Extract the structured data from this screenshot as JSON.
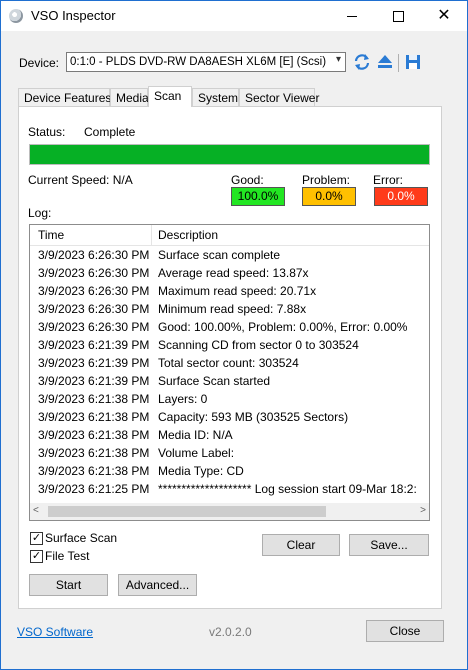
{
  "window": {
    "title": "VSO Inspector",
    "minimize": "–",
    "maximize": "□",
    "close": "✕"
  },
  "toolbar": {
    "device_label": "Device:",
    "device_value": "0:1:0 - PLDS DVD-RW DA8AESH XL6M [E] (Scsi)",
    "dropdown_arrow": "▾"
  },
  "tabs": [
    "Device Features",
    "Media",
    "Scan",
    "System",
    "Sector Viewer"
  ],
  "active_tab": "Scan",
  "scan": {
    "status_label": "Status:",
    "status_value": "Complete",
    "progress_fraction": 1.0,
    "progress_color": "#06b025",
    "speed_label": "Current Speed: N/A",
    "good_label": "Good:",
    "good_value": "100.0%",
    "good_color": "#22e622",
    "problem_label": "Problem:",
    "problem_value": "0.0%",
    "problem_color": "#ffc000",
    "error_label": "Error:",
    "error_value": "0.0%",
    "error_color": "#ff3b1a",
    "log_label": "Log:"
  },
  "log": {
    "columns": [
      "Time",
      "Description"
    ],
    "rows": [
      {
        "time": "3/9/2023 6:26:30 PM",
        "desc": "Surface scan complete"
      },
      {
        "time": "3/9/2023 6:26:30 PM",
        "desc": "Average read speed: 13.87x"
      },
      {
        "time": "3/9/2023 6:26:30 PM",
        "desc": "Maximum read speed: 20.71x"
      },
      {
        "time": "3/9/2023 6:26:30 PM",
        "desc": "Minimum read speed: 7.88x"
      },
      {
        "time": "3/9/2023 6:26:30 PM",
        "desc": "Good: 100.00%, Problem: 0.00%, Error: 0.00%"
      },
      {
        "time": "3/9/2023 6:21:39 PM",
        "desc": "Scanning CD from sector 0 to 303524"
      },
      {
        "time": "3/9/2023 6:21:39 PM",
        "desc": "Total sector count: 303524"
      },
      {
        "time": "3/9/2023 6:21:39 PM",
        "desc": "Surface Scan started"
      },
      {
        "time": "3/9/2023 6:21:38 PM",
        "desc": "Layers: 0"
      },
      {
        "time": "3/9/2023 6:21:38 PM",
        "desc": "Capacity: 593 MB (303525 Sectors)"
      },
      {
        "time": "3/9/2023 6:21:38 PM",
        "desc": "Media ID: N/A"
      },
      {
        "time": "3/9/2023 6:21:38 PM",
        "desc": "Volume Label:"
      },
      {
        "time": "3/9/2023 6:21:38 PM",
        "desc": "Media Type: CD"
      },
      {
        "time": "3/9/2023 6:21:25 PM",
        "desc": "******************** Log session start 09-Mar 18:2:"
      }
    ],
    "scroll_left": "<",
    "scroll_right": ">"
  },
  "options": {
    "surface_scan_label": "Surface Scan",
    "surface_scan_checked": true,
    "file_test_label": "File Test",
    "file_test_checked": true,
    "check_mark": "✓"
  },
  "buttons": {
    "clear": "Clear",
    "save": "Save...",
    "start": "Start",
    "advanced": "Advanced...",
    "close": "Close"
  },
  "footer": {
    "link": "VSO Software",
    "version": "v2.0.2.0"
  }
}
